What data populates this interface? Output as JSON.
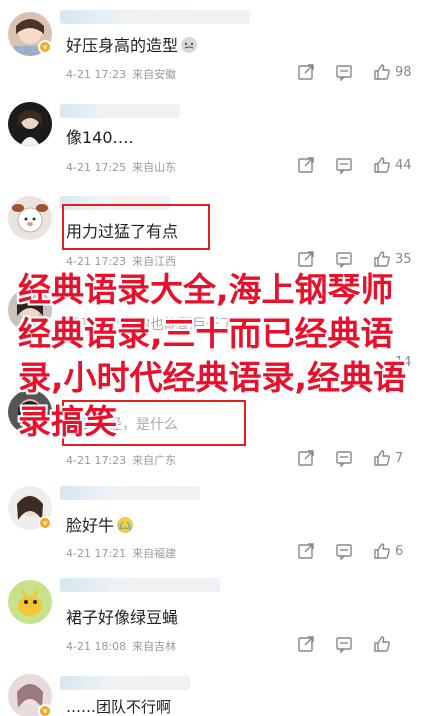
{
  "overlay_title": "经典语录大全,海上钢琴师经典语录,三十而已经典语录,小时代经典语录,经典语录搞笑",
  "comments": [
    {
      "text": "好压身高的造型",
      "emoji": "face-icon",
      "date": "4-21 17:23",
      "source": "来自安徽",
      "likes": "98"
    },
    {
      "text": "像140….",
      "date": "4-21 17:25",
      "source": "来自山东",
      "likes": "44"
    },
    {
      "text": "用力过猛了有点",
      "date": "4-21 17:23",
      "source": "来自江西",
      "likes": "35"
    },
    {
      "text": "妈呀这上衣你也能配巨长了",
      "date": "",
      "source": "",
      "likes": "14"
    },
    {
      "text": "老丧，经，是什么",
      "date": "4-21 17:23",
      "source": "来自广东",
      "likes": "7"
    },
    {
      "text": "脸好牛",
      "emoji": "crying-face-icon",
      "date": "4-21 17:21",
      "source": "来自福建",
      "likes": "6"
    },
    {
      "text": "裙子好像绿豆蝇",
      "date": "4-21 18:08",
      "source": "来自吉林",
      "likes": ""
    },
    {
      "text": "……团队不行啊",
      "date": "",
      "source": "",
      "likes": ""
    }
  ]
}
